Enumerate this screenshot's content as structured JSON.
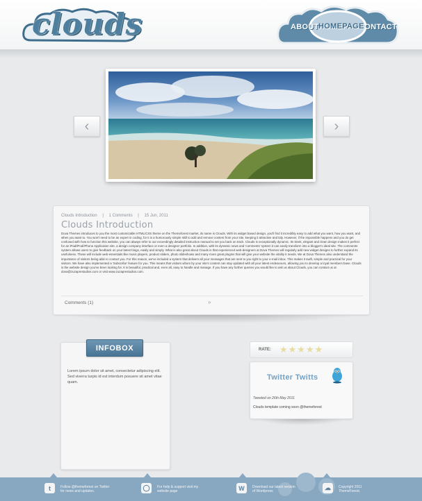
{
  "header": {
    "logo": "clouds",
    "nav": {
      "about": "ABOUT",
      "homepage": "HOMEPAGE",
      "contact": "CONTACT"
    }
  },
  "slider": {
    "prev_icon": "chevron-left-icon",
    "next_icon": "chevron-right-icon"
  },
  "post": {
    "meta_title": "Clouds Introduction",
    "meta_comments": "1 Comments",
    "meta_date": "15 Jun, 2011",
    "title": "Clouds Introduction",
    "body": "Dova Themes introduces to you the most customizable HTML/CSS theme on the Themeforest market, its name is Clouds. With its widget based design, you'll find it incredibly easy to add what you want, how you want, and when you want to. You won't need to be an expert in coding, for it is a humorously simple skill to add and remove content from your site, keeping it attractive and tidy. However, if the impossible happens and you do get confused with how to function this website, you can always refer to our exceedingly detailed instruction manual to set you back on track. Clouds is exceptionally dynamic. Its sleek, elegant and clean design makes it perfect for an iPad/iPod/iPhone Application site, a design company interface or even a designer portfolio. In addition, with its dynamic news and 'comments' system it can easily transform into a blogger's ideal site. The comments system allows users to give feedback on your latest blogs, easily and simply. What is also great about Clouds is that experienced web-designers at Dova Themes will regularly add new widget designs to further expand its usefulness. These will include web-essentials like music players, product sliders, photo slideshows and many more great plugins that will give your website the vitality it needs. We at Dova Themes also understand the importance of visitors being able to contact you. For this reason, we've included a system that delivers all your messages that are sent to you right to your e-mail inbox. This makes it swift, simple and practical for your visitors. We have also implemented a 'Subscribe' feature for you. This means that visitors whom by your site's content can stay updated with all your latest endeavours, allowing you to develop a loyal members base. Clouds is the website design you've been looking for. It is beautiful, practical and, even all, easy to handle and manage. If you have any further queries you would like to ask us about Clouds, you can contact us at dova@zuzaprestudios.com or visit www.zuzaprestudios.com.",
    "comments_link": "Comments (1)",
    "more_icon": "double-chevron-right-icon"
  },
  "infobox": {
    "title": "INFOBOX",
    "text": "Lorem ipsum dolor sit amet, consectetur adipiscing elit. Sed viverra turpis id est interdum posuere sit amet vitae quam."
  },
  "rating": {
    "label": "RATE:",
    "stars": "★★★★★",
    "value": 0
  },
  "twitter": {
    "title": "Twitter Twitts",
    "tweet_date": "Tweeted on 26th May 2011",
    "tweet_text": "Clouds template coming soon @themeforest"
  },
  "footer": {
    "items": [
      {
        "icon": "twitter-icon",
        "glyph": "t",
        "line1": "Follow @themeforest on Twitter",
        "line2": "for news and updates."
      },
      {
        "icon": "speech-bubble-icon",
        "glyph": "◯",
        "line1": "For help & support visit my",
        "line2": "website page"
      },
      {
        "icon": "wordpress-icon",
        "glyph": "W",
        "line1": "Download our latest version",
        "line2": "of Wordpress"
      },
      {
        "icon": "cloud-icon",
        "glyph": "☁",
        "line1": "Copyright 2011",
        "line2": "ThemeForest."
      }
    ]
  }
}
